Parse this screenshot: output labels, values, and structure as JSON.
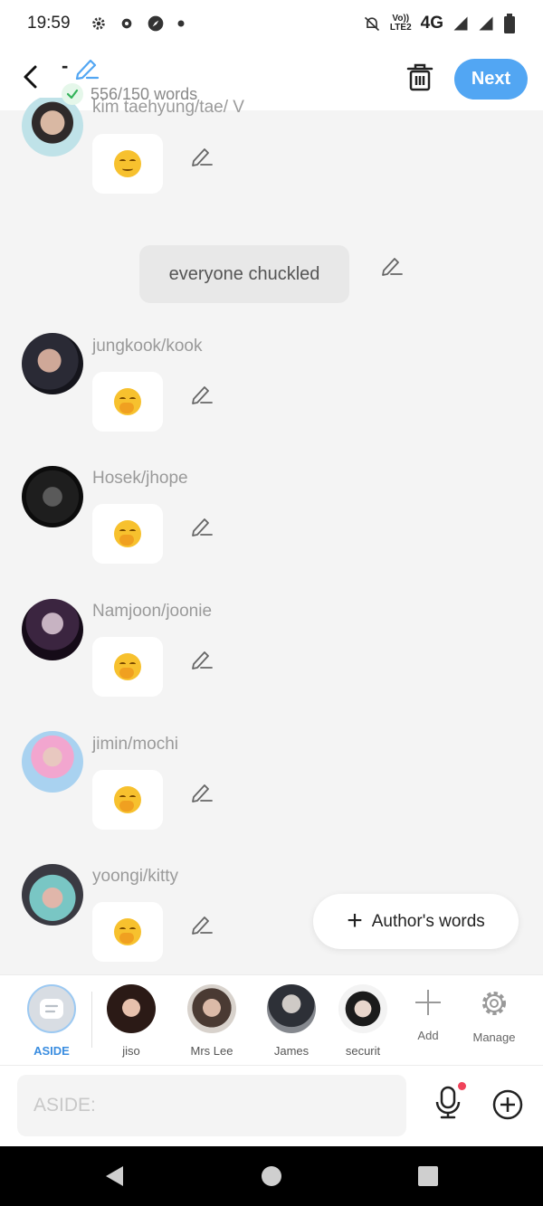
{
  "status_bar": {
    "time": "19:59",
    "volte_line1": "Vo))",
    "volte_line2": "LTE2",
    "network": "4G"
  },
  "header": {
    "title": "-",
    "word_count": "556/150 words",
    "next_label": "Next"
  },
  "messages": [
    {
      "name": "kim taehyung/tae/ V"
    },
    {
      "name": "jungkook/kook"
    },
    {
      "name": "Hosek/jhope"
    },
    {
      "name": "Namjoon/joonie"
    },
    {
      "name": "jimin/mochi"
    },
    {
      "name": "yoongi/kitty"
    }
  ],
  "narration": "everyone chuckled",
  "authors_words_label": "Author's words",
  "characters": [
    {
      "label": "ASIDE"
    },
    {
      "label": "jiso"
    },
    {
      "label": "Mrs Lee"
    },
    {
      "label": "James"
    },
    {
      "label": "securit"
    }
  ],
  "tools": {
    "add_label": "Add",
    "manage_label": "Manage"
  },
  "input": {
    "placeholder": "ASIDE:"
  },
  "colors": {
    "accent": "#52a6f3",
    "aside_label": "#3a8de0",
    "mic_dot": "#f0435a"
  }
}
